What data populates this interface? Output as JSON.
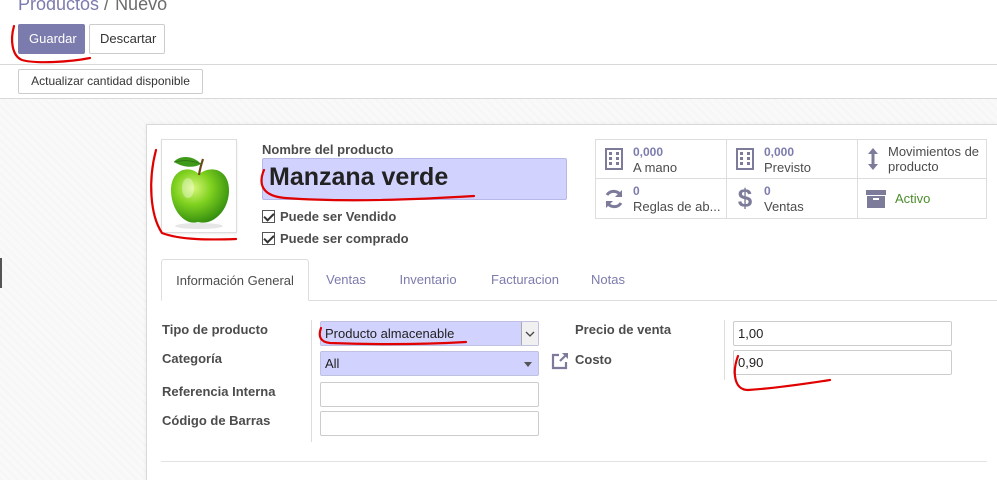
{
  "breadcrumb": {
    "parent": "Productos",
    "separator": "/",
    "current": "Nuevo"
  },
  "toolbar": {
    "save_label": "Guardar",
    "discard_label": "Descartar"
  },
  "statusbar": {
    "update_qty_label": "Actualizar cantidad disponible"
  },
  "product": {
    "name_label": "Nombre del producto",
    "name_value": "Manzana verde",
    "image_icon": "green-apple",
    "can_be_sold_label": "Puede ser Vendido",
    "can_be_sold": true,
    "can_be_purchased_label": "Puede ser comprado",
    "can_be_purchased": true
  },
  "stats": [
    {
      "icon": "building-icon",
      "value": "0,000",
      "label": "A mano"
    },
    {
      "icon": "building-icon",
      "value": "0,000",
      "label": "Previsto"
    },
    {
      "icon": "up-down-arrows-icon",
      "value": "",
      "label": "Movimientos de producto"
    },
    {
      "icon": "refresh-icon",
      "value": "0",
      "label": "Reglas de ab..."
    },
    {
      "icon": "dollar-icon",
      "value": "0",
      "label": "Ventas"
    },
    {
      "icon": "archive-icon",
      "value": "",
      "label": "Activo"
    }
  ],
  "tabs": [
    "Información General",
    "Ventas",
    "Inventario",
    "Facturacion",
    "Notas"
  ],
  "fields": {
    "type_label": "Tipo de producto",
    "type_value": "Producto almacenable",
    "category_label": "Categoría",
    "category_value": "All",
    "internal_ref_label": "Referencia Interna",
    "internal_ref_value": "",
    "barcode_label": "Código de Barras",
    "barcode_value": "",
    "sale_price_label": "Precio de venta",
    "sale_price_value": "1,00",
    "cost_label": "Costo",
    "cost_value": "0,90"
  },
  "colors": {
    "primary": "#7c7bad",
    "highlight": "#d2d2ff",
    "active_green": "#4d8c2c",
    "annotation_red": "#e00000"
  }
}
